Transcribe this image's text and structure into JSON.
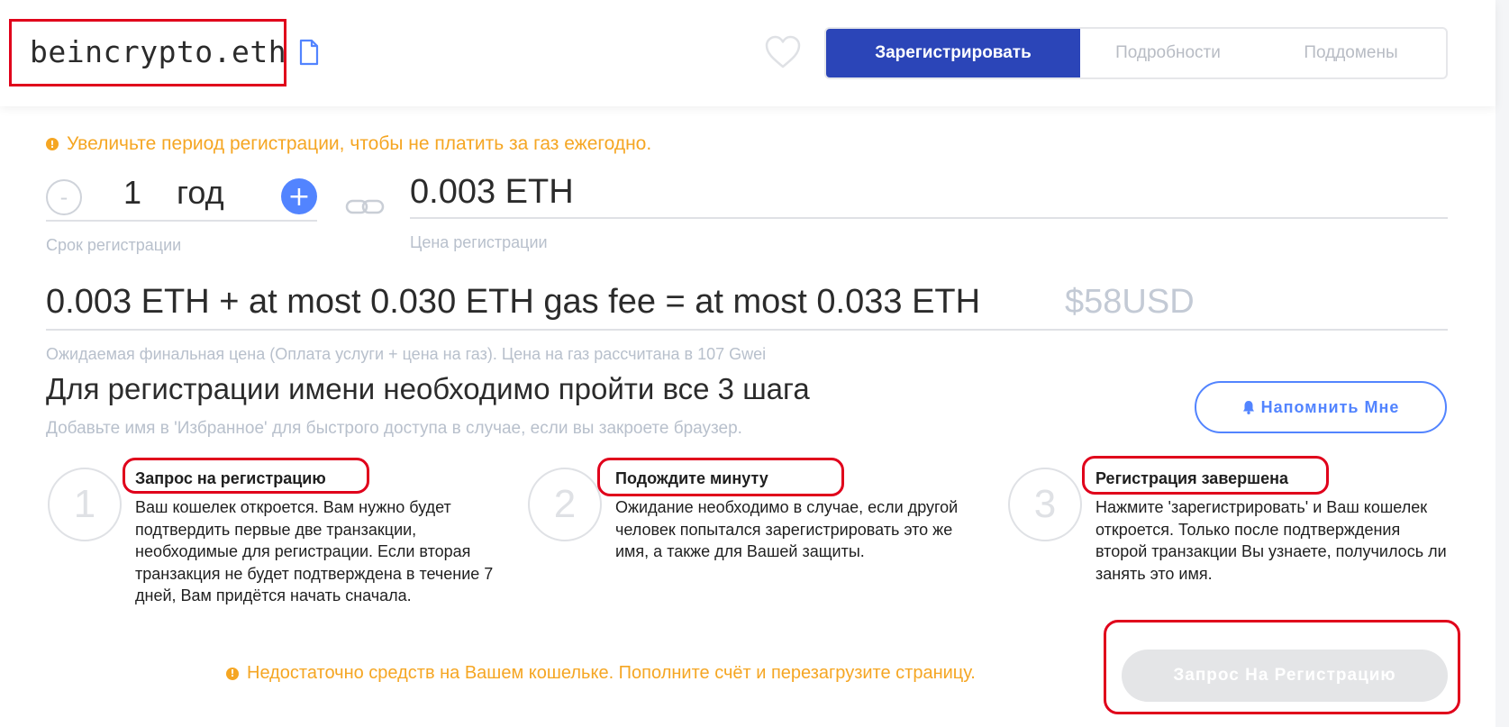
{
  "header": {
    "domain": "beincrypto.eth",
    "favorite_icon": "heart-icon",
    "copy_icon": "document-icon",
    "tabs": [
      {
        "label": "Зарегистрировать",
        "active": true
      },
      {
        "label": "Подробности",
        "active": false
      },
      {
        "label": "Поддомены",
        "active": false
      }
    ]
  },
  "registration": {
    "notice": "Увеличьте период регистрации, чтобы не платить за газ ежегодно.",
    "years_value": "1",
    "years_unit": "год",
    "years_label": "Срок регистрации",
    "minus_label": "-",
    "plus_label": "+",
    "price_value": "0.003 ETH",
    "price_label": "Цена регистрации",
    "total": "0.003 ETH + at most 0.030 ETH gas fee = at most 0.033 ETH",
    "total_usd": "$58USD",
    "total_note": "Ожидаемая финальная цена (Оплата услуги + цена на газ). Цена на газ рассчитана в 107 Gwei"
  },
  "steps_section": {
    "heading": "Для регистрации имени необходимо пройти все 3 шага",
    "subheading": "Добавьте имя в 'Избранное' для быстрого доступа в случае, если вы закроете браузер.",
    "remind_label": "Напомнить Мне",
    "steps": [
      {
        "number": "1",
        "title": "Запрос на регистрацию",
        "text": "Ваш кошелек откроется. Вам нужно будет подтвердить первые две транзакции, необходимые для регистрации. Если вторая транзакция не будет подтверждена в течение 7 дней, Вам придётся начать сначала."
      },
      {
        "number": "2",
        "title": "Подождите минуту",
        "text": "Ожидание необходимо в случае, если другой человек попытался зарегистрировать это же имя, а также для Вашей защиты."
      },
      {
        "number": "3",
        "title": "Регистрация завершена",
        "text": "Нажмите 'зарегистрировать' и Ваш кошелек откроется. Только после подтверждения второй транзакции Вы узнаете, получилось ли занять это имя."
      }
    ]
  },
  "footer": {
    "warning": "Недостаточно средств на Вашем кошельке. Пополните счёт и перезагрузите страницу.",
    "submit_label": "Запрос На Регистрацию"
  },
  "colors": {
    "primary": "#2b45b8",
    "accent": "#5284ff",
    "warning": "#f5a623",
    "annotation": "#e0001b"
  }
}
